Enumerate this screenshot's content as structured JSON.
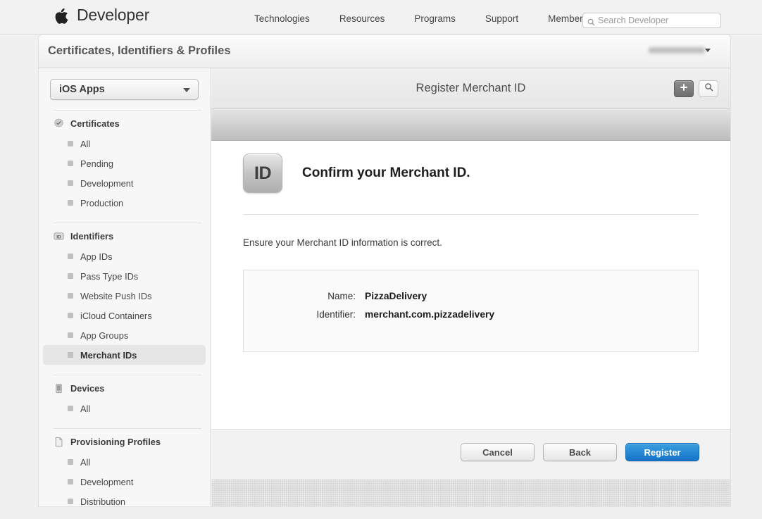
{
  "globalnav": {
    "brand": "Developer",
    "apple_icon": "apple-logo-icon",
    "links": [
      {
        "label": "Technologies"
      },
      {
        "label": "Resources"
      },
      {
        "label": "Programs"
      },
      {
        "label": "Support"
      },
      {
        "label": "Member Center"
      }
    ],
    "search": {
      "placeholder": "Search Developer",
      "value": "",
      "icon": "search-icon"
    }
  },
  "card": {
    "title": "Certificates, Identifiers & Profiles",
    "account_menu_caret": "chevron-down-icon"
  },
  "sidebar": {
    "platform_select": {
      "value": "iOS Apps",
      "caret": "chevron-down-icon"
    },
    "groups": [
      {
        "label": "Certificates",
        "icon": "certificate-seal-icon",
        "items": [
          {
            "label": "All",
            "selected": false
          },
          {
            "label": "Pending",
            "selected": false
          },
          {
            "label": "Development",
            "selected": false
          },
          {
            "label": "Production",
            "selected": false
          }
        ]
      },
      {
        "label": "Identifiers",
        "icon": "id-badge-icon",
        "items": [
          {
            "label": "App IDs",
            "selected": false
          },
          {
            "label": "Pass Type IDs",
            "selected": false
          },
          {
            "label": "Website Push IDs",
            "selected": false
          },
          {
            "label": "iCloud Containers",
            "selected": false
          },
          {
            "label": "App Groups",
            "selected": false
          },
          {
            "label": "Merchant IDs",
            "selected": true
          }
        ]
      },
      {
        "label": "Devices",
        "icon": "device-phone-icon",
        "items": [
          {
            "label": "All",
            "selected": false
          }
        ]
      },
      {
        "label": "Provisioning Profiles",
        "icon": "document-icon",
        "items": [
          {
            "label": "All",
            "selected": false
          },
          {
            "label": "Development",
            "selected": false
          },
          {
            "label": "Distribution",
            "selected": false
          }
        ]
      }
    ]
  },
  "content": {
    "title": "Register Merchant ID",
    "add_button_icon": "plus-icon",
    "search_button_icon": "search-icon",
    "panel": {
      "badge_text": "ID",
      "heading": "Confirm your Merchant ID.",
      "description": "Ensure your Merchant ID information is correct.",
      "fields": [
        {
          "label": "Name:",
          "value": "PizzaDelivery"
        },
        {
          "label": "Identifier:",
          "value": "merchant.com.pizzadelivery"
        }
      ]
    },
    "footer": {
      "cancel_label": "Cancel",
      "back_label": "Back",
      "register_label": "Register"
    }
  },
  "colors": {
    "accent_blue": "#1473c8",
    "page_bg": "#f0f0f0",
    "sidebar_bg": "#f7f7f7",
    "selected_item_bg": "#e6e6e6"
  }
}
